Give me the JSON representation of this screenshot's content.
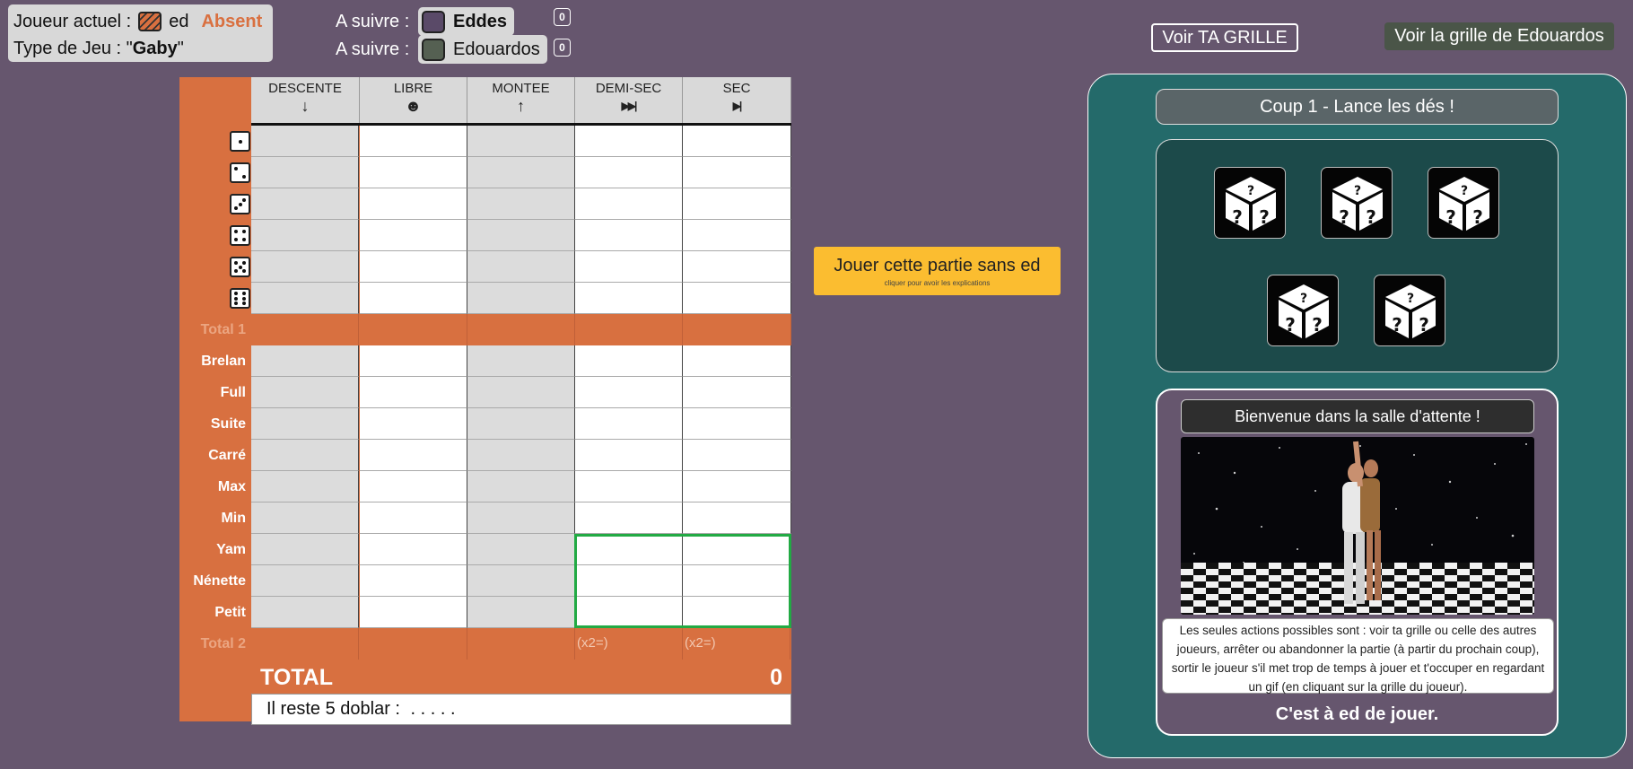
{
  "player": {
    "label": "Joueur actuel :",
    "name": "ed",
    "status": "Absent",
    "game_type_label": "Type de Jeu : \"",
    "game_type": "Gaby",
    "game_type_end": "\""
  },
  "next": [
    {
      "label": "A suivre :",
      "name": "Eddes",
      "color": "#5a4a68",
      "count": "0"
    },
    {
      "label": "A suivre :",
      "name": "Edouardos",
      "color": "#556052",
      "count": "0"
    }
  ],
  "buttons": {
    "my_grid": "Voir TA GRILLE",
    "other_grid": "Voir la grille de Edouardos",
    "play_without": "Jouer cette partie sans ed",
    "play_without_sub": "cliquer pour avoir les explications"
  },
  "grid": {
    "columns": [
      {
        "name": "DESCENTE",
        "arrow": "🡓"
      },
      {
        "name": "LIBRE",
        "arrow": "☻"
      },
      {
        "name": "MONTEE",
        "arrow": "🡑"
      },
      {
        "name": "DEMI-SEC",
        "arrow": "⏭"
      },
      {
        "name": "SEC",
        "arrow": "⏯"
      }
    ],
    "total1": "Total 1",
    "rows2": [
      "Brelan",
      "Full",
      "Suite",
      "Carré",
      "Max",
      "Min",
      "Yam",
      "Nénette",
      "Petit"
    ],
    "total2": "Total 2",
    "x2_label": "(x2=)",
    "total_label": "TOTAL",
    "total_value": "0",
    "remaining": "Il reste 5 doblar :",
    "remaining_dots": ". . . . ."
  },
  "panel": {
    "coup": "Coup 1 - Lance les dés !",
    "wait_title": "Bienvenue dans la salle d'attente !",
    "explain": "Les seules actions possibles sont : voir ta grille ou celle des autres joueurs, arrêter ou abandonner la partie (à partir du prochain coup), sortir le joueur s'il met trop de temps à jouer et t'occuper en regardant un gif (en cliquant sur la grille du joueur).",
    "turn": "C'est à ed de jouer."
  },
  "colors": {
    "background": "#66566e",
    "grid_orange": "#d87040",
    "panel_teal": "#246a6a",
    "play_yellow": "#fbbd30",
    "highlight_green": "#22aa44"
  }
}
